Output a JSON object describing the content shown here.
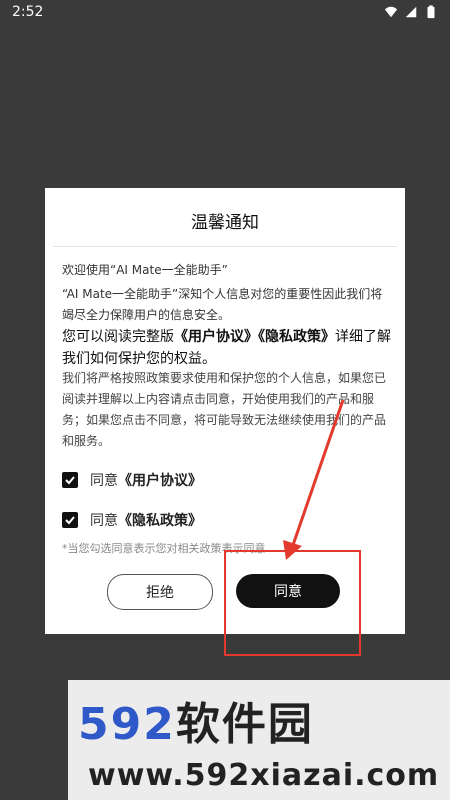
{
  "statusbar": {
    "time": "2:52"
  },
  "dialog": {
    "title": "温馨通知",
    "welcome": "欢迎使用“AI Mate一全能助手”",
    "intro": "“AI Mate一全能助手”深知个人信息对您的重要性因此我们将竭尽全力保障用户的信息安全。",
    "read_prefix": "您可以阅读完整版",
    "user_agreement": "《用户协议》",
    "privacy_policy": "《隐私政策》",
    "read_suffix": "详细了解我们如何保护您的权益。",
    "policy_text": "我们将严格按照政策要求使用和保护您的个人信息，如果您已阅读并理解以上内容请点击同意，开始使用我们的产品和服务；如果您点击不同意，将可能导致无法继续使用我们的产品和服务。",
    "agree_prefix": "同意",
    "check1_doc": "《用户协议》",
    "check2_doc": "《隐私政策》",
    "hint": "*当您勾选同意表示您对相关政策表示同意",
    "reject_label": "拒绝",
    "agree_label": "同意"
  },
  "watermark": {
    "brand_num": "592",
    "brand_cn": "软件园",
    "url": "www.592xiazai.com"
  },
  "colors": {
    "accent_red": "#e23b2e",
    "brand_blue": "#2f58c8"
  }
}
